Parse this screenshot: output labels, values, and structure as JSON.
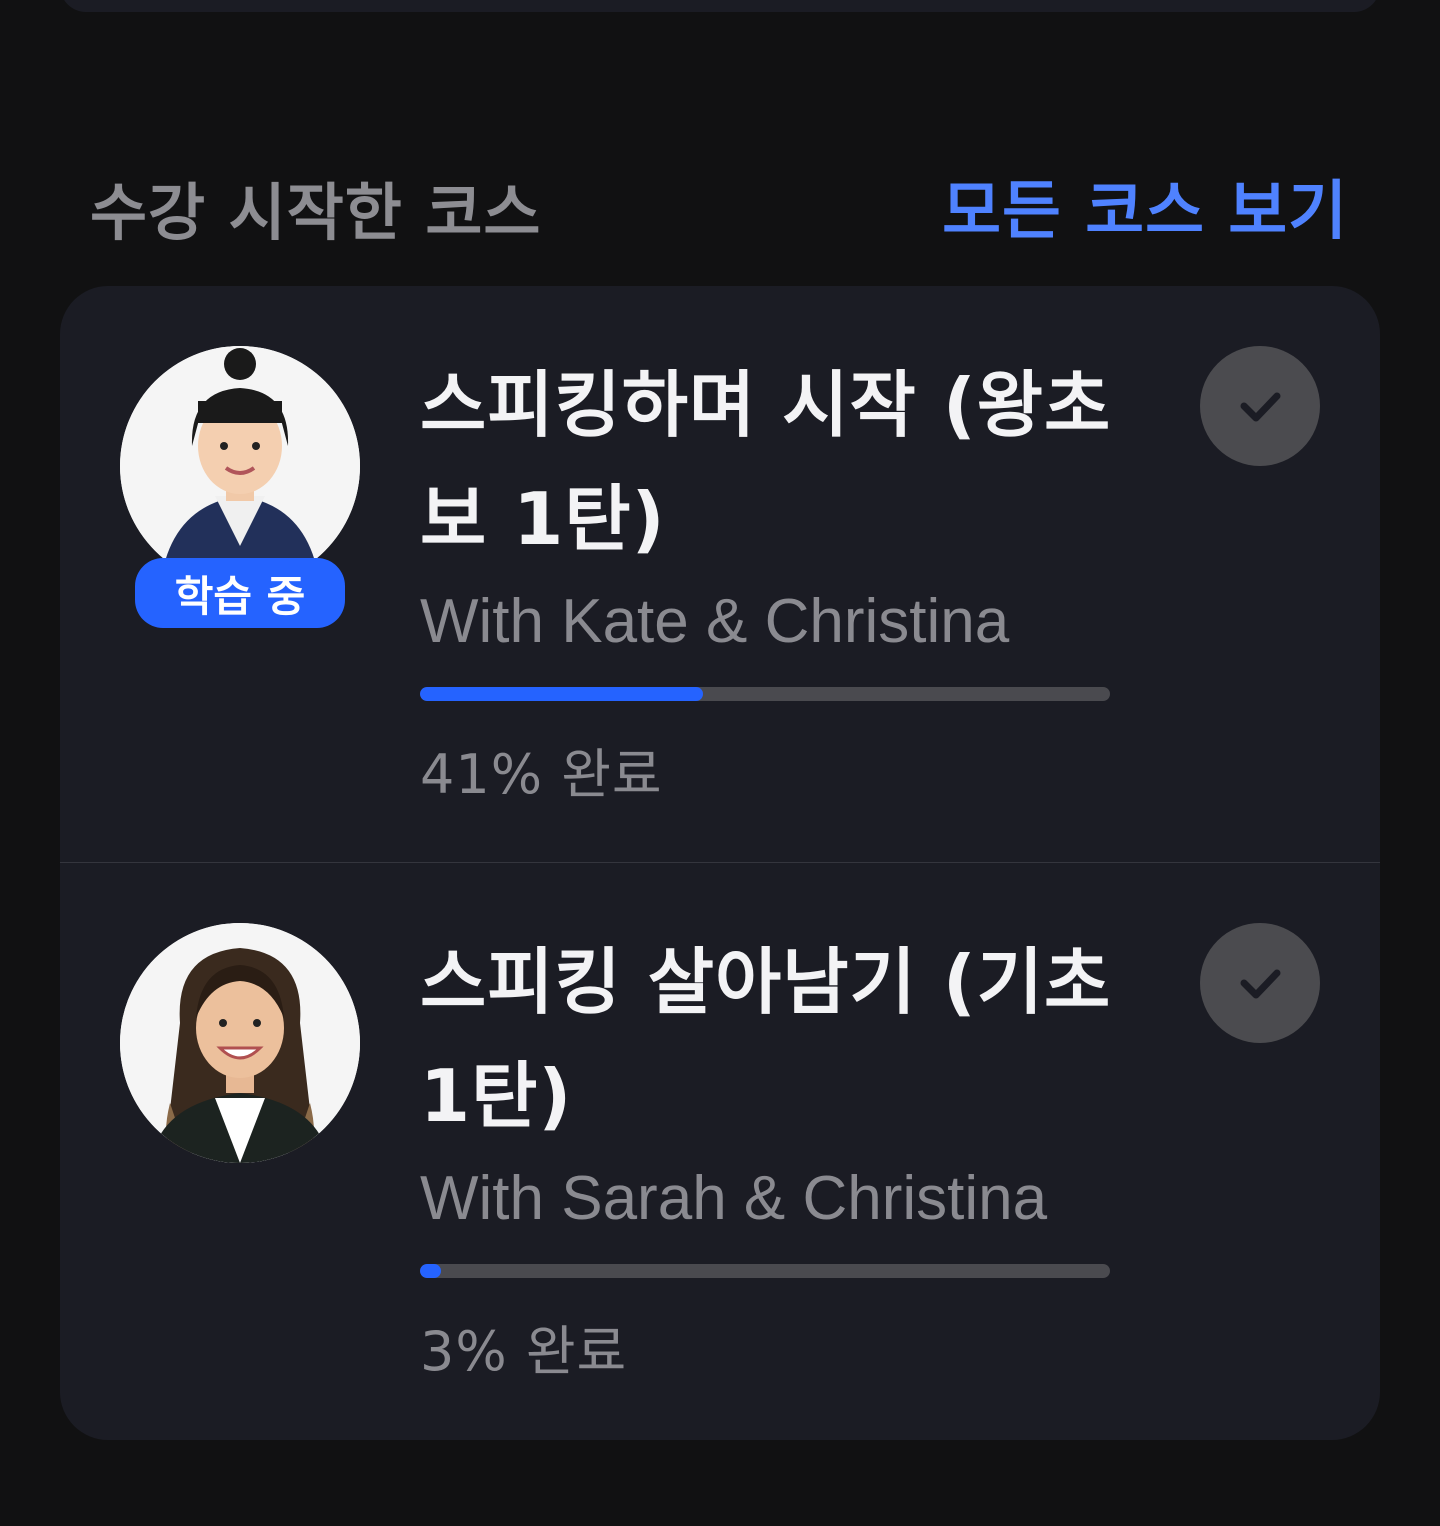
{
  "section": {
    "title": "수강 시작한 코스",
    "view_all_label": "모든 코스 보기",
    "accent_color": "#4f82ff"
  },
  "courses": [
    {
      "title": "스피킹하며 시작 (왕초보 1탄)",
      "instructors": "With Kate & Christina",
      "progress_fraction": 0.41,
      "progress_label": "41% 완료",
      "badge": "학습 중",
      "check_icon": "check-icon"
    },
    {
      "title": "스피킹 살아남기 (기초 1탄)",
      "instructors": "With Sarah & Christina",
      "progress_fraction": 0.03,
      "progress_label": "3% 완료",
      "check_icon": "check-icon"
    }
  ],
  "colors": {
    "background": "#111112",
    "card": "#1b1c24",
    "progress_fill": "#2563ff",
    "progress_track": "#4a4a4f",
    "badge": "#2563ff"
  }
}
